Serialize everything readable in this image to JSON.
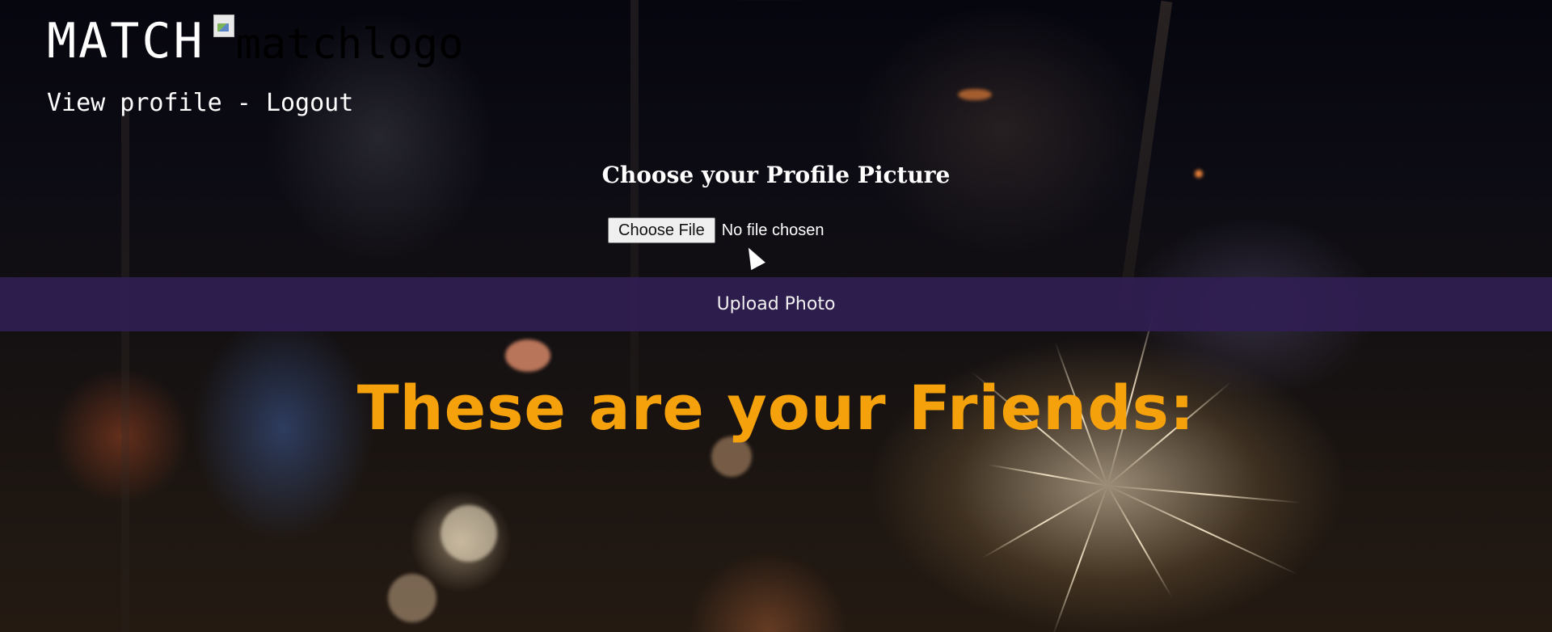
{
  "header": {
    "brand_title": "MATCH",
    "logo_alt": "matchlogo",
    "nav": {
      "view_profile": "View profile",
      "separator": " - ",
      "logout": "Logout"
    }
  },
  "upload": {
    "heading": "Choose your Profile Picture",
    "file_button": "Choose File",
    "file_status": "No file chosen",
    "submit_label": "Upload Photo"
  },
  "friends": {
    "heading": "These are your Friends:"
  },
  "colors": {
    "friends_heading": "#f5a10c",
    "upload_bar": "#301e52"
  }
}
